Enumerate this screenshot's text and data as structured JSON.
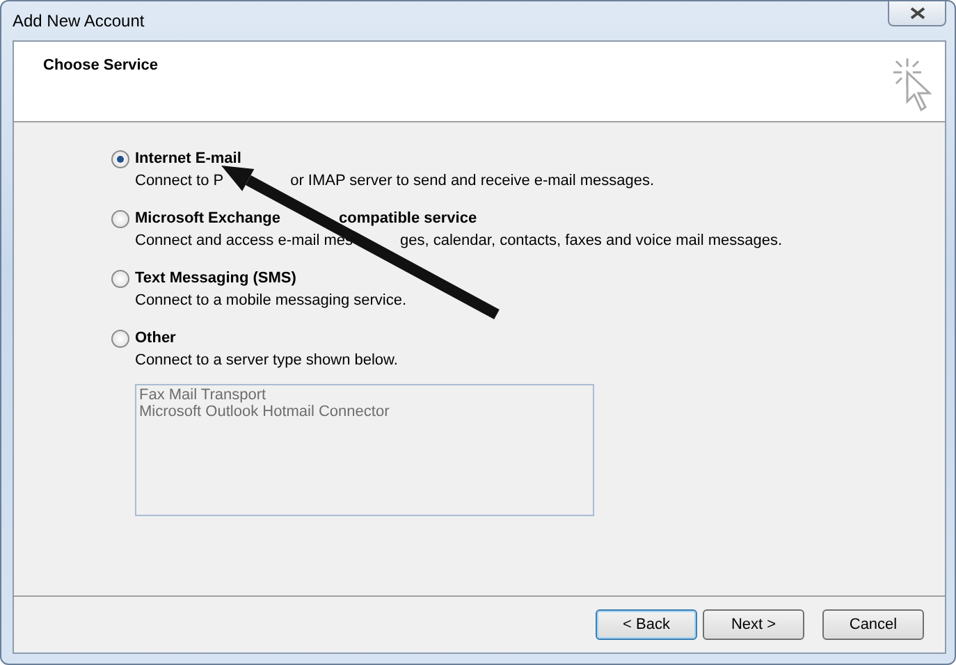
{
  "window": {
    "title": "Add New Account"
  },
  "header": {
    "title": "Choose Service"
  },
  "options": [
    {
      "label": [
        "Internet E-mail"
      ],
      "description": [
        "Connect to P",
        "or IMAP server to send and receive e-mail messages."
      ],
      "selected": true
    },
    {
      "label": [
        "Microsoft Exchange",
        "compatible service"
      ],
      "description": [
        "Connect and access e-mail mes",
        "ges, calendar, contacts, faxes and voice mail messages."
      ],
      "selected": false
    },
    {
      "label": [
        "Text Messaging (SMS)"
      ],
      "description": [
        "Connect to a mobile messaging service."
      ],
      "selected": false
    },
    {
      "label": [
        "Other"
      ],
      "description": [
        "Connect to a server type shown below."
      ],
      "selected": false
    }
  ],
  "server_list": {
    "disabled": true,
    "items": [
      "Fax Mail Transport",
      "Microsoft Outlook Hotmail Connector"
    ]
  },
  "buttons": [
    {
      "label": "< Back",
      "default": true
    },
    {
      "label": "Next >",
      "default": false
    },
    {
      "label": "Cancel",
      "default": false
    }
  ]
}
